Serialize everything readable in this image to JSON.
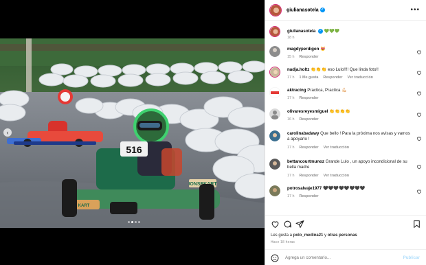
{
  "post": {
    "username": "giulianasotela",
    "more_icon": "ellipsis-icon",
    "caption_emojis": "💚💚💚",
    "caption_time": "18 h",
    "accent": "#0095f6"
  },
  "comments": [
    {
      "user": "magdyperdigon",
      "text": "😻",
      "time": "15 h",
      "actions": [
        "Responder"
      ]
    },
    {
      "user": "nadja.holtz",
      "text": "👏👏👏 eso Lulo!!!! Que linda foto!!",
      "time": "17 h",
      "actions": [
        "1 Me gusta",
        "Responder",
        "Ver traducción"
      ]
    },
    {
      "user": "aktracing",
      "text": "Practica, Practica 💪🏻",
      "time": "17 h",
      "actions": [
        "Responder"
      ]
    },
    {
      "user": "olivaresreyesmiguel",
      "text": "👏👏👏👏",
      "time": "16 h",
      "actions": [
        "Responder"
      ]
    },
    {
      "user": "carolinabadawy",
      "text": "Que bello ! Para la próxima nos avisas y vamos a apoyarlo ! ",
      "time": "17 h",
      "actions": [
        "Responder",
        "Ver traducción"
      ]
    },
    {
      "user": "bettancourtmunoz",
      "text": "Grande Lulo , un apoyo incondicional de su bella madre",
      "time": "17 h",
      "actions": [
        "Responder",
        "Ver traducción"
      ]
    },
    {
      "user": "potrosalvaje1977",
      "text": "🖤🖤🖤🖤🖤🖤🖤🖤",
      "time": "17 h",
      "actions": [
        "Responder"
      ]
    }
  ],
  "actions_bar": {
    "like_prefix": "Les gusta a ",
    "like_user": "polo_medina21",
    "like_mid": " y ",
    "like_others": "otras personas",
    "posted": "Hace 18 horas"
  },
  "composer": {
    "placeholder": "Agrega un comentario...",
    "publish": "Publicar"
  },
  "photo": {
    "kart_number": "516",
    "sponsor": "IONSEKART",
    "front_sponsor": "KART"
  }
}
